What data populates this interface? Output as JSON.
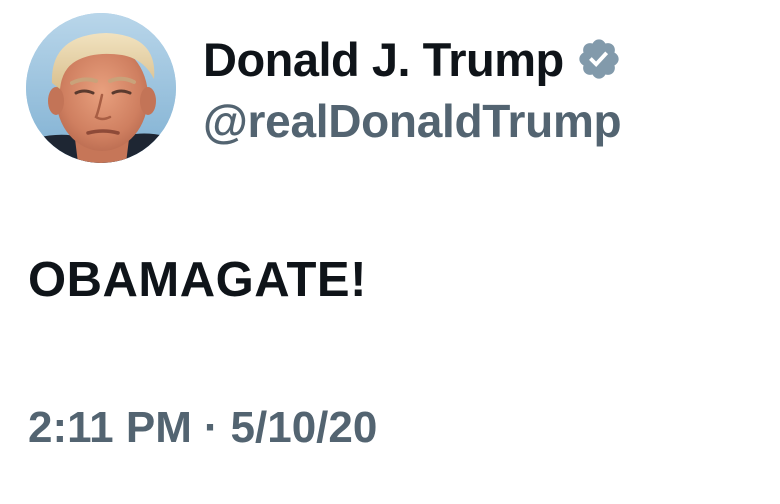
{
  "author": {
    "display_name": "Donald J. Trump",
    "handle": "@realDonaldTrump",
    "verified": true,
    "verified_icon": "verified-badge-icon",
    "avatar": "profile-photo"
  },
  "tweet": {
    "text": "OBAMAGATE!",
    "time": "2:11 PM",
    "separator": "·",
    "date": "5/10/20"
  },
  "colors": {
    "primary_text": "#0f1419",
    "secondary_text": "#536471",
    "badge": "#829aab",
    "background": "#ffffff"
  }
}
